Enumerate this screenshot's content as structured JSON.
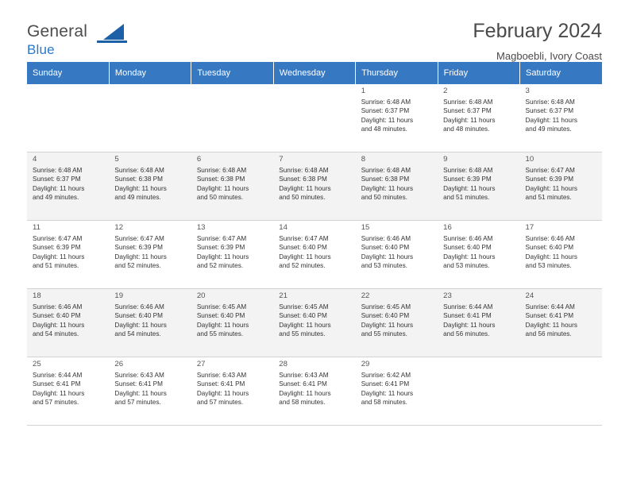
{
  "brand": {
    "line1": "General",
    "line2": "Blue",
    "mark": "triangle-logo"
  },
  "header": {
    "title": "February 2024",
    "location": "Magboebli, Ivory Coast"
  },
  "calendar": {
    "weekdays": [
      "Sunday",
      "Monday",
      "Tuesday",
      "Wednesday",
      "Thursday",
      "Friday",
      "Saturday"
    ],
    "weeks": [
      [
        {
          "day": "",
          "lines": []
        },
        {
          "day": "",
          "lines": []
        },
        {
          "day": "",
          "lines": []
        },
        {
          "day": "",
          "lines": []
        },
        {
          "day": "1",
          "lines": [
            "Sunrise: 6:48 AM",
            "Sunset: 6:37 PM",
            "Daylight: 11 hours",
            "and 48 minutes."
          ]
        },
        {
          "day": "2",
          "lines": [
            "Sunrise: 6:48 AM",
            "Sunset: 6:37 PM",
            "Daylight: 11 hours",
            "and 48 minutes."
          ]
        },
        {
          "day": "3",
          "lines": [
            "Sunrise: 6:48 AM",
            "Sunset: 6:37 PM",
            "Daylight: 11 hours",
            "and 49 minutes."
          ]
        }
      ],
      [
        {
          "day": "4",
          "lines": [
            "Sunrise: 6:48 AM",
            "Sunset: 6:37 PM",
            "Daylight: 11 hours",
            "and 49 minutes."
          ]
        },
        {
          "day": "5",
          "lines": [
            "Sunrise: 6:48 AM",
            "Sunset: 6:38 PM",
            "Daylight: 11 hours",
            "and 49 minutes."
          ]
        },
        {
          "day": "6",
          "lines": [
            "Sunrise: 6:48 AM",
            "Sunset: 6:38 PM",
            "Daylight: 11 hours",
            "and 50 minutes."
          ]
        },
        {
          "day": "7",
          "lines": [
            "Sunrise: 6:48 AM",
            "Sunset: 6:38 PM",
            "Daylight: 11 hours",
            "and 50 minutes."
          ]
        },
        {
          "day": "8",
          "lines": [
            "Sunrise: 6:48 AM",
            "Sunset: 6:38 PM",
            "Daylight: 11 hours",
            "and 50 minutes."
          ]
        },
        {
          "day": "9",
          "lines": [
            "Sunrise: 6:48 AM",
            "Sunset: 6:39 PM",
            "Daylight: 11 hours",
            "and 51 minutes."
          ]
        },
        {
          "day": "10",
          "lines": [
            "Sunrise: 6:47 AM",
            "Sunset: 6:39 PM",
            "Daylight: 11 hours",
            "and 51 minutes."
          ]
        }
      ],
      [
        {
          "day": "11",
          "lines": [
            "Sunrise: 6:47 AM",
            "Sunset: 6:39 PM",
            "Daylight: 11 hours",
            "and 51 minutes."
          ]
        },
        {
          "day": "12",
          "lines": [
            "Sunrise: 6:47 AM",
            "Sunset: 6:39 PM",
            "Daylight: 11 hours",
            "and 52 minutes."
          ]
        },
        {
          "day": "13",
          "lines": [
            "Sunrise: 6:47 AM",
            "Sunset: 6:39 PM",
            "Daylight: 11 hours",
            "and 52 minutes."
          ]
        },
        {
          "day": "14",
          "lines": [
            "Sunrise: 6:47 AM",
            "Sunset: 6:40 PM",
            "Daylight: 11 hours",
            "and 52 minutes."
          ]
        },
        {
          "day": "15",
          "lines": [
            "Sunrise: 6:46 AM",
            "Sunset: 6:40 PM",
            "Daylight: 11 hours",
            "and 53 minutes."
          ]
        },
        {
          "day": "16",
          "lines": [
            "Sunrise: 6:46 AM",
            "Sunset: 6:40 PM",
            "Daylight: 11 hours",
            "and 53 minutes."
          ]
        },
        {
          "day": "17",
          "lines": [
            "Sunrise: 6:46 AM",
            "Sunset: 6:40 PM",
            "Daylight: 11 hours",
            "and 53 minutes."
          ]
        }
      ],
      [
        {
          "day": "18",
          "lines": [
            "Sunrise: 6:46 AM",
            "Sunset: 6:40 PM",
            "Daylight: 11 hours",
            "and 54 minutes."
          ]
        },
        {
          "day": "19",
          "lines": [
            "Sunrise: 6:46 AM",
            "Sunset: 6:40 PM",
            "Daylight: 11 hours",
            "and 54 minutes."
          ]
        },
        {
          "day": "20",
          "lines": [
            "Sunrise: 6:45 AM",
            "Sunset: 6:40 PM",
            "Daylight: 11 hours",
            "and 55 minutes."
          ]
        },
        {
          "day": "21",
          "lines": [
            "Sunrise: 6:45 AM",
            "Sunset: 6:40 PM",
            "Daylight: 11 hours",
            "and 55 minutes."
          ]
        },
        {
          "day": "22",
          "lines": [
            "Sunrise: 6:45 AM",
            "Sunset: 6:40 PM",
            "Daylight: 11 hours",
            "and 55 minutes."
          ]
        },
        {
          "day": "23",
          "lines": [
            "Sunrise: 6:44 AM",
            "Sunset: 6:41 PM",
            "Daylight: 11 hours",
            "and 56 minutes."
          ]
        },
        {
          "day": "24",
          "lines": [
            "Sunrise: 6:44 AM",
            "Sunset: 6:41 PM",
            "Daylight: 11 hours",
            "and 56 minutes."
          ]
        }
      ],
      [
        {
          "day": "25",
          "lines": [
            "Sunrise: 6:44 AM",
            "Sunset: 6:41 PM",
            "Daylight: 11 hours",
            "and 57 minutes."
          ]
        },
        {
          "day": "26",
          "lines": [
            "Sunrise: 6:43 AM",
            "Sunset: 6:41 PM",
            "Daylight: 11 hours",
            "and 57 minutes."
          ]
        },
        {
          "day": "27",
          "lines": [
            "Sunrise: 6:43 AM",
            "Sunset: 6:41 PM",
            "Daylight: 11 hours",
            "and 57 minutes."
          ]
        },
        {
          "day": "28",
          "lines": [
            "Sunrise: 6:43 AM",
            "Sunset: 6:41 PM",
            "Daylight: 11 hours",
            "and 58 minutes."
          ]
        },
        {
          "day": "29",
          "lines": [
            "Sunrise: 6:42 AM",
            "Sunset: 6:41 PM",
            "Daylight: 11 hours",
            "and 58 minutes."
          ]
        },
        {
          "day": "",
          "lines": []
        },
        {
          "day": "",
          "lines": []
        }
      ]
    ]
  },
  "colors": {
    "header_blue": "#3778c2",
    "brand_blue": "#2b78c8",
    "shade": "#f3f3f3"
  }
}
